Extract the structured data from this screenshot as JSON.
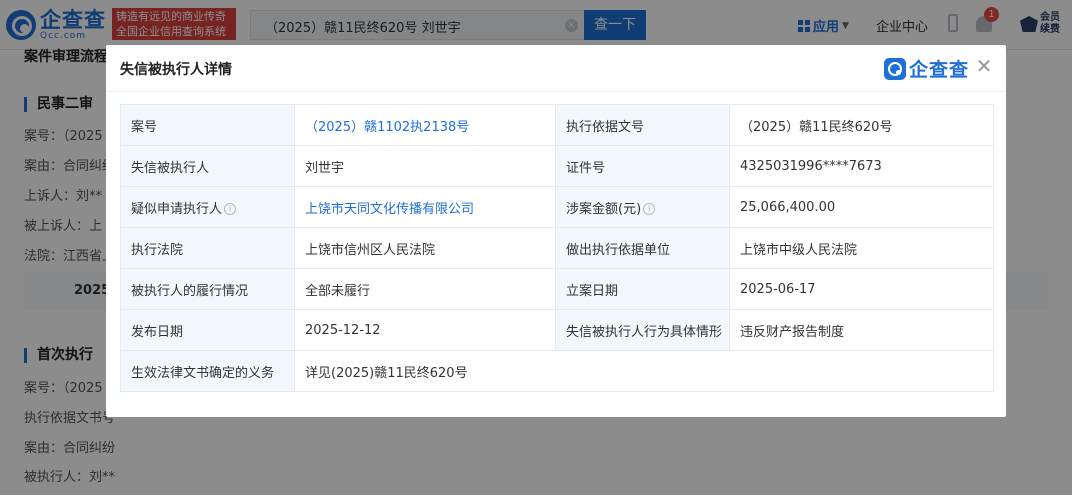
{
  "topbar": {
    "logo_name": "企查查",
    "logo_domain": "Qcc.com",
    "slogan_line1": "铸造有远见的商业传奇",
    "slogan_line2": "全国企业信用查询系统",
    "search_value": "（2025）赣11民终620号 刘世宇",
    "search_button": "查一下",
    "app_menu": "应用",
    "enterprise_center": "企业中心",
    "notification_count": "1",
    "vip_line1": "会员",
    "vip_line2": "续费"
  },
  "page": {
    "section_title": "案件审理流程",
    "civil_second": {
      "title": "民事二审",
      "lines": [
        "案号：（2025",
        "案由：合同纠纷",
        "上诉人：刘**",
        "被上诉人：上",
        "法院：江西省上"
      ]
    },
    "strip_text": "2025",
    "first_exec": {
      "title": "首次执行",
      "lines": [
        "案号：（2025",
        "执行依据文书号",
        "案由：合同纠纷",
        "被执行人：刘**"
      ]
    }
  },
  "modal": {
    "title": "失信被执行人详情",
    "brand": "企查查",
    "rows": [
      {
        "k1": "案号",
        "v1": "（2025）赣1102执2138号",
        "k2": "执行依据文号",
        "v2": "（2025）赣11民终620号"
      },
      {
        "k1": "失信被执行人",
        "v1": "刘世宇",
        "k2": "证件号",
        "v2": "4325031996****7673"
      },
      {
        "k1": "疑似申请执行人",
        "v1": "上饶市天同文化传播有限公司",
        "k2": "涉案金额(元)",
        "v2": "25,066,400.00"
      },
      {
        "k1": "执行法院",
        "v1": "上饶市信州区人民法院",
        "k2": "做出执行依据单位",
        "v2": "上饶市中级人民法院"
      },
      {
        "k1": "被执行人的履行情况",
        "v1": "全部未履行",
        "k2": "立案日期",
        "v2": "2025-06-17"
      },
      {
        "k1": "发布日期",
        "v1": "2025-12-12",
        "k2": "失信被执行人行为具体情形",
        "v2": "违反财产报告制度"
      },
      {
        "k1": "生效法律文书确定的义务",
        "v1": "详见(2025)赣11民终620号"
      }
    ]
  },
  "colors": {
    "brand": "#1f6fd6",
    "slogan_bg": "#d9413c",
    "key_cell_bg": "#f2f7fc"
  }
}
